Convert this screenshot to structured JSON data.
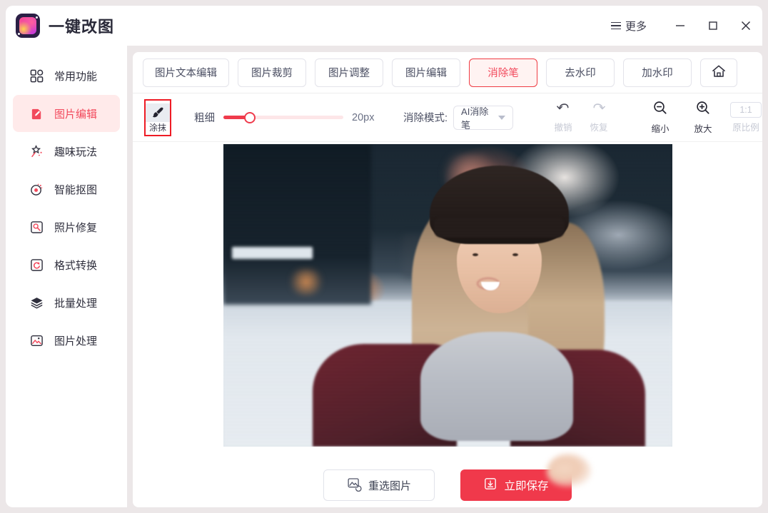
{
  "window": {
    "title": "一键改图",
    "more_label": "更多",
    "minimize_label": "最小化",
    "maximize_label": "最大化",
    "close_label": "关闭"
  },
  "sidebar": {
    "items": [
      {
        "label": "常用功能",
        "icon": "grid-icon",
        "active": false
      },
      {
        "label": "图片编辑",
        "icon": "pencil-edit-icon",
        "active": true
      },
      {
        "label": "趣味玩法",
        "icon": "magic-wand-icon",
        "active": false
      },
      {
        "label": "智能抠图",
        "icon": "cutout-target-icon",
        "active": false
      },
      {
        "label": "照片修复",
        "icon": "photo-repair-icon",
        "active": false
      },
      {
        "label": "格式转换",
        "icon": "convert-refresh-icon",
        "active": false
      },
      {
        "label": "批量处理",
        "icon": "layers-icon",
        "active": false
      },
      {
        "label": "图片处理",
        "icon": "image-icon",
        "active": false
      }
    ]
  },
  "tabs": [
    {
      "label": "图片文本编辑",
      "active": false
    },
    {
      "label": "图片裁剪",
      "active": false
    },
    {
      "label": "图片调整",
      "active": false
    },
    {
      "label": "图片编辑",
      "active": false
    },
    {
      "label": "消除笔",
      "active": true
    },
    {
      "label": "去水印",
      "active": false
    },
    {
      "label": "加水印",
      "active": false
    }
  ],
  "home_tab": {
    "icon": "home-icon",
    "label": "首页"
  },
  "toolbar": {
    "brush_tool": {
      "label": "涂抹",
      "icon": "brush-icon",
      "selected": true
    },
    "thickness_label": "粗细",
    "thickness_value": "20px",
    "thickness_percent": 22,
    "mode_label": "消除模式:",
    "mode_value": "AI消除笔",
    "undo_label": "撤销",
    "redo_label": "恢复",
    "zoom_out_label": "缩小",
    "zoom_in_label": "放大",
    "ratio_value": "1:1",
    "ratio_label": "原比例"
  },
  "canvas": {
    "photo_alt": "雪地中微笑的戴毛线帽的女子照片"
  },
  "bottom": {
    "reselect_label": "重选图片",
    "reselect_icon": "image-swap-icon",
    "save_label": "立即保存",
    "save_icon": "download-icon"
  },
  "colors": {
    "accent": "#f0394b",
    "accent_soft": "#ffeaea",
    "tab_active_border": "#ef3b43",
    "tool_highlight": "#ee1c25",
    "page_bg": "#ece7e8",
    "panel_bg": "#ffffff",
    "text": "#2f2f3d",
    "muted_text": "#6b7186",
    "disabled_text": "#c6c9d4"
  }
}
